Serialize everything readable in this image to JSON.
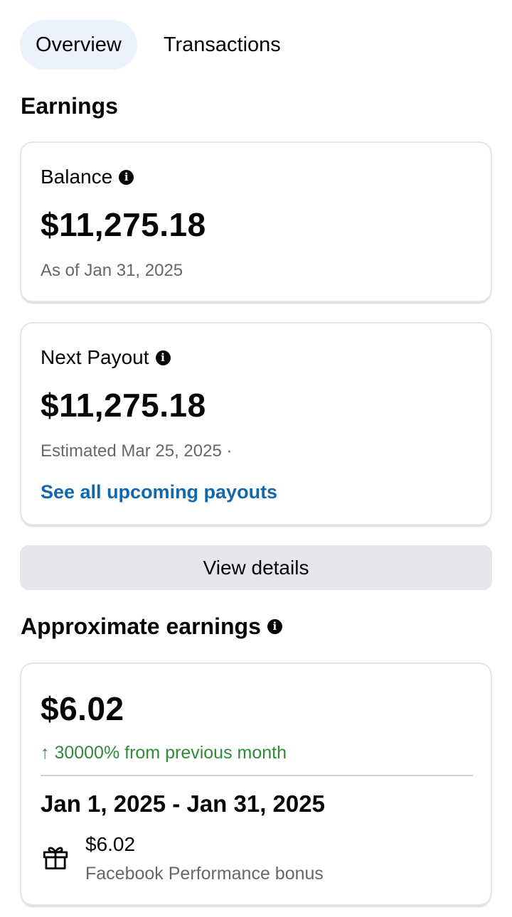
{
  "tabs": {
    "overview": "Overview",
    "transactions": "Transactions"
  },
  "earnings": {
    "title": "Earnings",
    "balance": {
      "label": "Balance",
      "amount": "$11,275.18",
      "as_of": "As of Jan 31, 2025"
    },
    "next_payout": {
      "label": "Next Payout",
      "amount": "$11,275.18",
      "estimated": "Estimated Mar 25, 2025 ·",
      "link": "See all upcoming payouts"
    },
    "view_details": "View details"
  },
  "approximate": {
    "title": "Approximate earnings",
    "amount": "$6.02",
    "trend": "↑ 30000% from previous month",
    "range": "Jan 1, 2025 - Jan 31, 2025",
    "bonus_amount": "$6.02",
    "bonus_label": "Facebook Performance bonus"
  },
  "icons": {
    "info": "info-icon",
    "gift": "gift-icon"
  },
  "colors": {
    "link": "#1268b0",
    "trend_up": "#2f8a3a",
    "active_tab_bg": "#ebf2fd",
    "button_bg": "#e4e6eb"
  }
}
